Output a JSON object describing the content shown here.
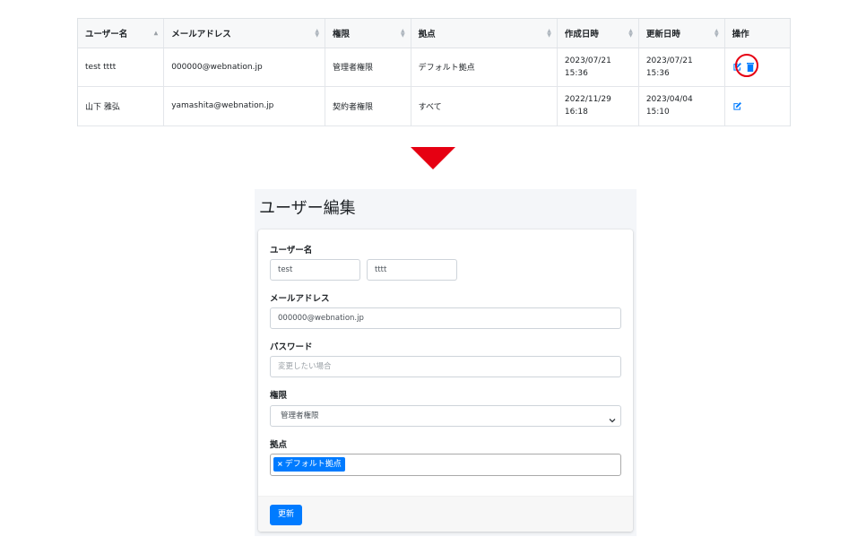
{
  "table": {
    "columns": [
      {
        "label": "ユーザー名",
        "sort": "asc"
      },
      {
        "label": "メールアドレス",
        "sort": "both"
      },
      {
        "label": "権限",
        "sort": "both"
      },
      {
        "label": "拠点",
        "sort": "both"
      },
      {
        "label": "作成日時",
        "sort": "both"
      },
      {
        "label": "更新日時",
        "sort": "both"
      },
      {
        "label": "操作",
        "sort": "none"
      }
    ],
    "rows": [
      {
        "name": "test tttt",
        "email": "000000@webnation.jp",
        "role": "管理者権限",
        "location": "デフォルト拠点",
        "created_date": "2023/07/21",
        "created_time": "15:36",
        "updated_date": "2023/07/21",
        "updated_time": "15:36"
      },
      {
        "name": "山下 雅弘",
        "email": "yamashita@webnation.jp",
        "role": "契約者権限",
        "location": "すべて",
        "created_date": "2022/11/29",
        "created_time": "16:18",
        "updated_date": "2023/04/04",
        "updated_time": "15:10"
      }
    ]
  },
  "edit": {
    "title": "ユーザー編集",
    "username_label": "ユーザー名",
    "first_name": "test",
    "last_name": "tttt",
    "email_label": "メールアドレス",
    "email_value": "000000@webnation.jp",
    "password_label": "パスワード",
    "password_placeholder": "変更したい場合",
    "role_label": "権限",
    "role_value": "管理者権限",
    "location_label": "拠点",
    "location_tag": "デフォルト拠点",
    "tag_remove": "×",
    "update_button": "更新"
  },
  "colors": {
    "accent": "#007bff",
    "highlight": "#e60012",
    "panel_bg": "#f4f6f9"
  },
  "icons": [
    "sort-icon",
    "edit-icon",
    "delete-icon",
    "down-arrow-icon",
    "chevron-down-icon"
  ]
}
